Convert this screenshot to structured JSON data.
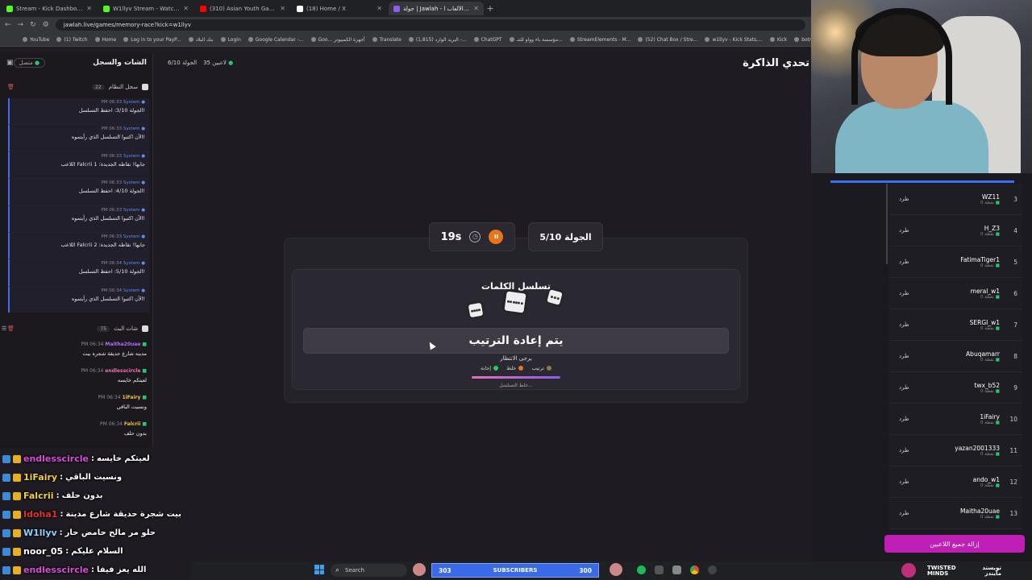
{
  "browser": {
    "tabs": [
      {
        "title": "Stream - Kick Dashboard",
        "color": "#53fc18"
      },
      {
        "title": "W1llyv Stream - Watch Live on",
        "color": "#53fc18"
      },
      {
        "title": "(310) Asian Youth Games S",
        "color": "#ff0000"
      },
      {
        "title": "(18) Home / X",
        "color": "#ffffff"
      },
      {
        "title": "جولة | Jawlah - منصة الألعاب ا",
        "color": "#8a5cf0"
      }
    ],
    "url": "jawlah.live/games/memory-race?kick=w1llyv",
    "bookmarks": [
      "YouTube",
      "(1) Twitch",
      "Home",
      "Log in to your PayP...",
      "بنك البلاد",
      "Login",
      "Google Calendar -...",
      "Goo... أجهزة الكمبيوتر",
      "Translate",
      "(1,815) البريد الوارد -...",
      "ChatGPT",
      "مؤسسة باء وواو للتنـ...",
      "StreamElements - M...",
      "(52) Chat Box / Stre...",
      "w1llyv - Kick Stats,...",
      "Kick",
      "botrix"
    ]
  },
  "left_panel": {
    "title": "الشات والسجل",
    "status": "متصل",
    "system_log": {
      "title": "سجل النظام",
      "count": "22",
      "entries": [
        {
          "time": "PM 06:33",
          "sender": "System",
          "text": "الجولة 3/10: احفظ التسلسل!"
        },
        {
          "time": "PM 06:33",
          "sender": "System",
          "text": "الآن اكتبوا التسلسل الذي رأيتموه!"
        },
        {
          "time": "PM 06:33",
          "sender": "System",
          "text": "اللاعب Falcrii جابها! نقاطه الجديدة: 1"
        },
        {
          "time": "PM 06:33",
          "sender": "System",
          "text": "الجولة 4/10: احفظ التسلسل!"
        },
        {
          "time": "PM 06:33",
          "sender": "System",
          "text": "الآن اكتبوا التسلسل الذي رأيتموه!"
        },
        {
          "time": "PM 06:33",
          "sender": "System",
          "text": "اللاعب Falcrii جابها! نقاطه الجديدة: 2"
        },
        {
          "time": "PM 06:34",
          "sender": "System",
          "text": "الجولة 5/10: احفظ التسلسل!"
        },
        {
          "time": "PM 06:34",
          "sender": "System",
          "text": "الآن اكتبوا التسلسل الذي رأيتموه!"
        }
      ]
    },
    "stream_chat": {
      "title": "شات البث",
      "count": "75",
      "messages": [
        {
          "time": "PM 06:34",
          "user": "Maitha20uae",
          "color": "#b36bff",
          "text": "مدينه شارع حديقة شجره بيت"
        },
        {
          "time": "PM 06:34",
          "user": "endlesscircle",
          "color": "#e86fb8",
          "text": "لعيتكم خايسه"
        },
        {
          "time": "PM 06:34",
          "user": "1iFairy",
          "color": "#f0c040",
          "text": "ونسيت الباقي"
        },
        {
          "time": "PM 06:34",
          "user": "Falcrii",
          "color": "#f0c040",
          "text": "بدون حلف"
        }
      ]
    }
  },
  "game": {
    "title": "تحدي الذاكرة",
    "players_online": "35 لاعبين",
    "round_top": "الجولة 6/10",
    "round": "الجولة 5/10",
    "timer": "19s",
    "name": "تسلسل الكلمات",
    "banner": "يتم  إعادة الترتيب",
    "waiting": "يرجى الانتظار",
    "legend": [
      {
        "label": "إجابة",
        "color": "#28c76f"
      },
      {
        "label": "خلط",
        "color": "#e8751a"
      },
      {
        "label": "ترتيب",
        "color": "#8a7a50"
      }
    ],
    "progress": 1.0,
    "progress_text": "خلط التسلسل..."
  },
  "players": {
    "kick_label": "طرد",
    "points_label": "0 نقطة",
    "list": [
      {
        "rank": "3",
        "name": "WZ11"
      },
      {
        "rank": "4",
        "name": "H_Z3"
      },
      {
        "rank": "5",
        "name": "FatimaTiger1"
      },
      {
        "rank": "6",
        "name": "meral_w1"
      },
      {
        "rank": "7",
        "name": "SERGI_w1"
      },
      {
        "rank": "8",
        "name": "Abuqamarr"
      },
      {
        "rank": "9",
        "name": "twx_b52"
      },
      {
        "rank": "10",
        "name": "1iFairy"
      },
      {
        "rank": "11",
        "name": "yazan2001333"
      },
      {
        "rank": "12",
        "name": "ando_w1"
      },
      {
        "rank": "13",
        "name": "Maitha20uae"
      }
    ],
    "remove_all": "إزالة جميع اللاعبين"
  },
  "overlay_chat": [
    {
      "user": "endlesscircle",
      "color": "#d94dd9",
      "text": "لعيتكم خايسه"
    },
    {
      "user": "1iFairy",
      "color": "#f0d040",
      "text": "ونسيت الباقي"
    },
    {
      "user": "Falcrii",
      "color": "#f0d040",
      "text": "بدون حلف"
    },
    {
      "user": "Idoha1",
      "color": "#e03030",
      "text": "بيت شجرة حديقة شارع مدينة"
    },
    {
      "user": "W1llyv",
      "color": "#8fd0ff",
      "text": "حلو مر مالح حامض حار"
    },
    {
      "user": "noor_05",
      "color": "#ffffff",
      "text": "السلام عليكم"
    },
    {
      "user": "endlesscircle",
      "color": "#d94dd9",
      "text": "الله يعز فيفا"
    }
  ],
  "taskbar": {
    "search": "Search",
    "subs_left": "303",
    "subs_label": "SUBSCRIBERS",
    "subs_right": "300",
    "brand_line1": "TWISTED",
    "brand_line2": "MINDS",
    "brand_ar1": "تويستد",
    "brand_ar2": "مايندز"
  }
}
